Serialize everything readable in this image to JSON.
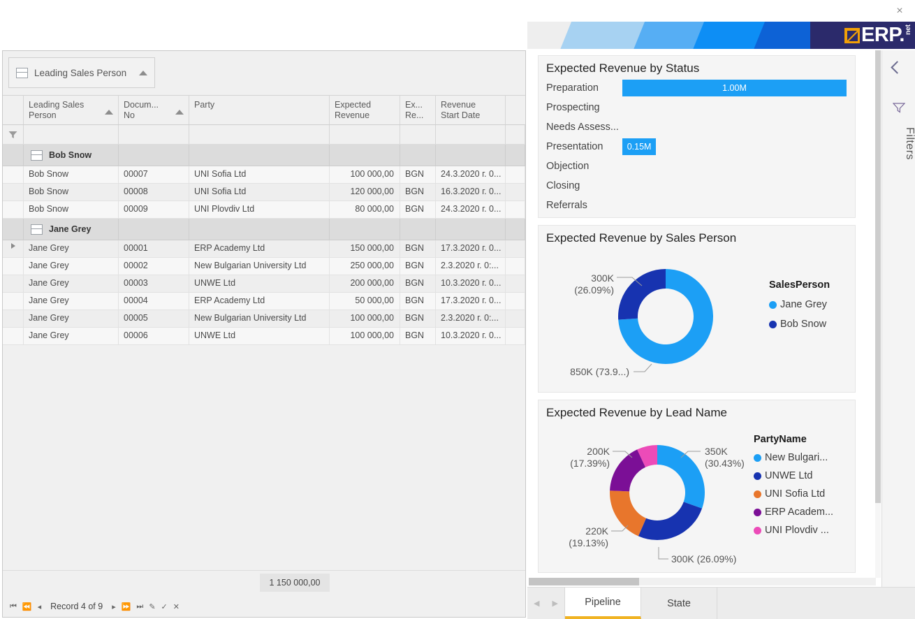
{
  "window": {
    "close_label": "×"
  },
  "brand": {
    "name": "ERP.",
    "suffix": "net"
  },
  "grid": {
    "group_chip": {
      "label": "Leading Sales Person",
      "icon": "group-box-icon",
      "sort": "ascending"
    },
    "search_icon": "search-icon",
    "filter_icon": "filter-funnel-icon",
    "columns": [
      {
        "label": "",
        "key": "indicator"
      },
      {
        "label": "Leading Sales\nPerson",
        "key": "sales_person",
        "sorted": "asc"
      },
      {
        "label": "Docum...\nNo",
        "key": "document_no",
        "sorted": "asc"
      },
      {
        "label": "Party",
        "key": "party"
      },
      {
        "label": "Expected\nRevenue",
        "key": "expected_revenue"
      },
      {
        "label": "Ex...\nRe...",
        "key": "currency"
      },
      {
        "label": "Revenue\nStart Date",
        "key": "revenue_start_date"
      },
      {
        "label": "",
        "key": "spare"
      }
    ],
    "groups": [
      {
        "name": "Bob Snow",
        "rows": [
          {
            "sales_person": "Bob Snow",
            "document_no": "00007",
            "party": "UNI Sofia Ltd",
            "expected_revenue": "100 000,00",
            "currency": "BGN",
            "revenue_start_date": "24.3.2020 г. 0...",
            "current": false
          },
          {
            "sales_person": "Bob Snow",
            "document_no": "00008",
            "party": "UNI Sofia Ltd",
            "expected_revenue": "120 000,00",
            "currency": "BGN",
            "revenue_start_date": "16.3.2020 г. 0...",
            "current": false
          },
          {
            "sales_person": "Bob Snow",
            "document_no": "00009",
            "party": "UNI Plovdiv Ltd",
            "expected_revenue": "80 000,00",
            "currency": "BGN",
            "revenue_start_date": "24.3.2020 г. 0...",
            "current": false
          }
        ]
      },
      {
        "name": "Jane Grey",
        "rows": [
          {
            "sales_person": "Jane Grey",
            "document_no": "00001",
            "party": "ERP Academy Ltd",
            "expected_revenue": "150 000,00",
            "currency": "BGN",
            "revenue_start_date": "17.3.2020 г. 0...",
            "current": true
          },
          {
            "sales_person": "Jane Grey",
            "document_no": "00002",
            "party": "New Bulgarian University Ltd",
            "expected_revenue": "250 000,00",
            "currency": "BGN",
            "revenue_start_date": "2.3.2020 г. 0:...",
            "current": false
          },
          {
            "sales_person": "Jane Grey",
            "document_no": "00003",
            "party": "UNWE Ltd",
            "expected_revenue": "200 000,00",
            "currency": "BGN",
            "revenue_start_date": "10.3.2020 г. 0...",
            "current": false
          },
          {
            "sales_person": "Jane Grey",
            "document_no": "00004",
            "party": "ERP Academy Ltd",
            "expected_revenue": "50 000,00",
            "currency": "BGN",
            "revenue_start_date": "17.3.2020 г. 0...",
            "current": false
          },
          {
            "sales_person": "Jane Grey",
            "document_no": "00005",
            "party": "New Bulgarian University Ltd",
            "expected_revenue": "100 000,00",
            "currency": "BGN",
            "revenue_start_date": "2.3.2020 г. 0:...",
            "current": false
          },
          {
            "sales_person": "Jane Grey",
            "document_no": "00006",
            "party": "UNWE Ltd",
            "expected_revenue": "100 000,00",
            "currency": "BGN",
            "revenue_start_date": "10.3.2020 г. 0...",
            "current": false
          }
        ]
      }
    ],
    "total": "1 150 000,00",
    "nav": {
      "first": "⏮",
      "prev_page": "⏪",
      "prev": "◂",
      "record_label": "Record 4 of 9",
      "next": "▸",
      "next_page": "⏩",
      "last": "⏭",
      "edit": "✎",
      "confirm": "✓",
      "cancel": "✕"
    }
  },
  "chart_data": [
    {
      "type": "bar",
      "title": "Expected Revenue by Status",
      "orientation": "horizontal",
      "categories": [
        "Preparation",
        "Prospecting",
        "Needs Assess...",
        "Presentation",
        "Objection",
        "Closing",
        "Referrals"
      ],
      "values": [
        1.0,
        0,
        0,
        0.15,
        0,
        0,
        0
      ],
      "labels": [
        "1.00M",
        "",
        "",
        "0.15M",
        "",
        "",
        ""
      ],
      "unit": "M",
      "xlabel": "",
      "ylabel": "",
      "xlim": [
        0,
        1.0
      ],
      "grid": false,
      "legend": "none",
      "bar_color": "#1c9ff5"
    },
    {
      "type": "pie",
      "subtype": "donut",
      "title": "Expected Revenue by Sales Person",
      "legend_title": "SalesPerson",
      "legend_position": "right",
      "categories": [
        "Jane Grey",
        "Bob Snow"
      ],
      "values": [
        850000,
        300000
      ],
      "percents": [
        73.91,
        26.09
      ],
      "labels": [
        "850K (73.9...)",
        "300K\n(26.09%)"
      ],
      "colors": [
        "#1c9ff5",
        "#1733b0"
      ]
    },
    {
      "type": "pie",
      "subtype": "donut",
      "title": "Expected Revenue by Lead Name",
      "legend_title": "PartyName",
      "legend_position": "right",
      "categories": [
        "New Bulgari...",
        "UNWE Ltd",
        "UNI Sofia Ltd",
        "ERP Academ...",
        "UNI Plovdiv ..."
      ],
      "values": [
        350000,
        300000,
        220000,
        200000,
        80000
      ],
      "percents": [
        30.43,
        26.09,
        19.13,
        17.39,
        6.96
      ],
      "labels": [
        "350K\n(30.43%)",
        "300K (26.09%)",
        "220K\n(19.13%)",
        "200K\n(17.39%)",
        ""
      ],
      "colors": [
        "#1c9ff5",
        "#1733b0",
        "#e8762c",
        "#7b0f96",
        "#ec4bb8"
      ]
    }
  ],
  "filters_rail": {
    "collapse_icon": "chevron-left-icon",
    "funnel_icon": "filter-funnel-icon",
    "label": "Filters"
  },
  "bottom_tabs": {
    "prev_icon": "chevron-left-icon",
    "next_icon": "chevron-right-icon",
    "tabs": [
      {
        "label": "Pipeline",
        "active": true
      },
      {
        "label": "State",
        "active": false
      }
    ]
  }
}
